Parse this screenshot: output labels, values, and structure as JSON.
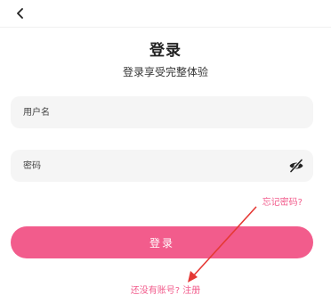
{
  "header": {
    "back_icon": "chevron-left-icon"
  },
  "title": "登录",
  "subtitle": "登录享受完整体验",
  "form": {
    "username_placeholder": "用户名",
    "password_placeholder": "密码",
    "password_toggle_icon": "eye-off-icon",
    "forgot_label": "忘记密码?"
  },
  "login_button": "登录",
  "register": {
    "prompt": "还没有账号?",
    "link": "注册"
  },
  "colors": {
    "accent": "#f25c8c",
    "field_bg": "#f5f5f5",
    "annotation_arrow": "#e53935"
  }
}
